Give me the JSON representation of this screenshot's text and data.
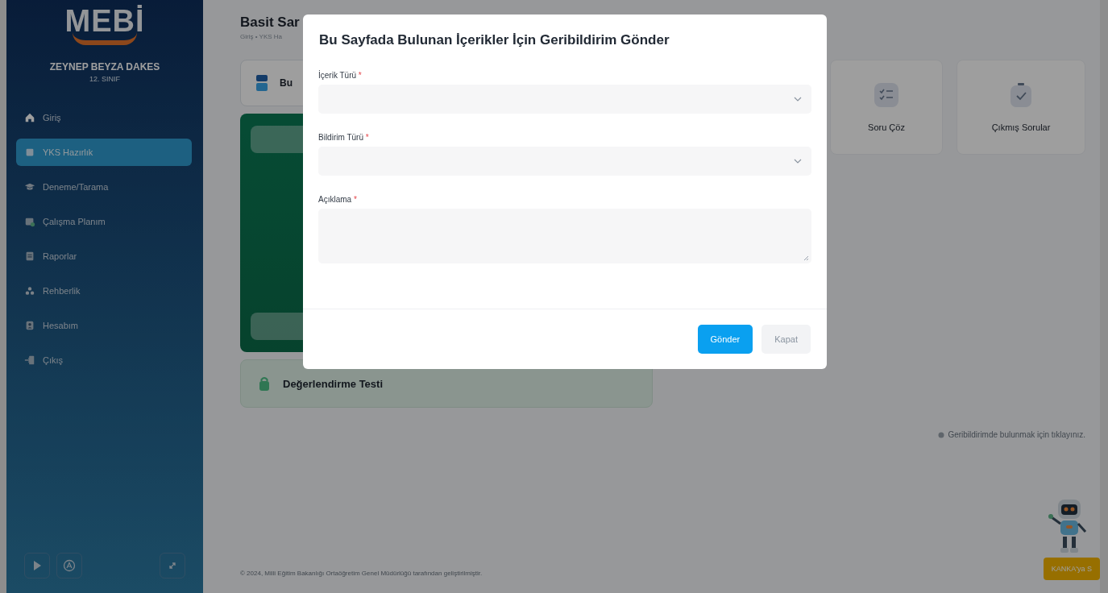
{
  "sidebar": {
    "logo": "MEBİ",
    "user_name": "ZEYNEP BEYZA DAKES",
    "grade": "12. SINIF",
    "items": [
      {
        "label": "Giriş",
        "selected": false
      },
      {
        "label": "YKS Hazırlık",
        "selected": true
      },
      {
        "label": "Deneme/Tarama",
        "selected": false
      },
      {
        "label": "Çalışma Planım",
        "selected": false
      },
      {
        "label": "Raporlar",
        "selected": false
      },
      {
        "label": "Rehberlik",
        "selected": false
      },
      {
        "label": "Hesabım",
        "selected": false
      },
      {
        "label": "Çıkış",
        "selected": false
      }
    ]
  },
  "page": {
    "title": "Basit Sar",
    "breadcrumb": "Giriş • YKS Ha",
    "lesson_card": "Bu",
    "tiles": [
      {
        "label": "Soru Çöz"
      },
      {
        "label": "Çıkmış Sorular"
      }
    ],
    "test_card": "Değerlendirme Testi",
    "feedback_hint": "Geribildirimde bulunmak için tıklayınız.",
    "footer": "© 2024, Milli Eğitim Bakanlığı Ortaöğretim Genel Müdürlüğü tarafından geliştirilmiştir.",
    "assistant_button": "KANKA'ya S"
  },
  "dialog": {
    "title": "Bu Sayfada Bulunan İçerikler İçin Geribildirim Gönder",
    "fields": [
      {
        "label": "İçerik Türü",
        "required_mark": "*",
        "kind": "select"
      },
      {
        "label": "Bildirim Türü",
        "required_mark": "*",
        "kind": "select"
      },
      {
        "label": "Açıklama",
        "required_mark": "*",
        "kind": "textarea"
      }
    ],
    "buttons": [
      {
        "label": "Gönder",
        "kind": "primary"
      },
      {
        "label": "Kapat",
        "kind": "secondary"
      }
    ]
  }
}
